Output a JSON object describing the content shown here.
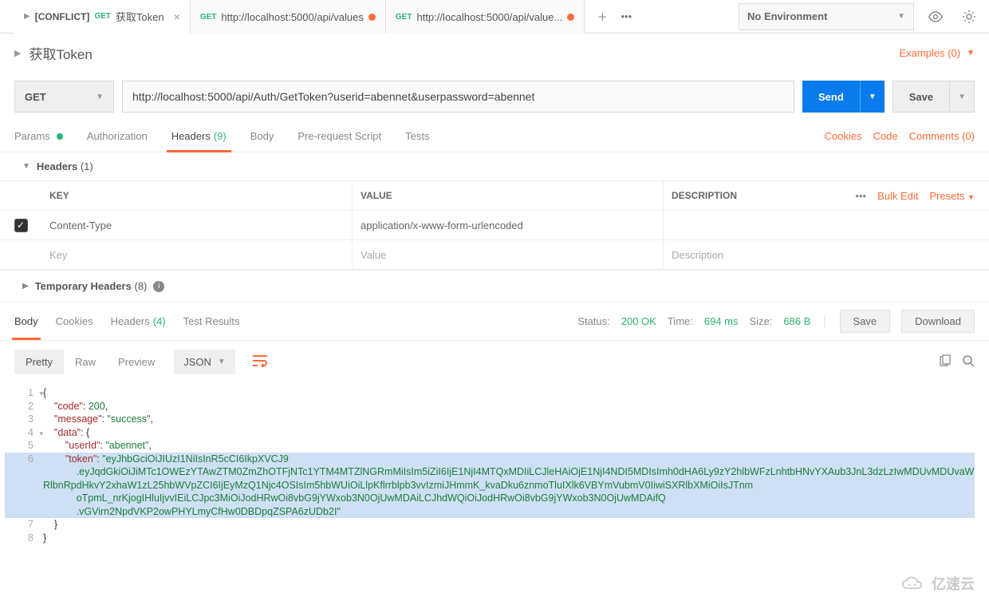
{
  "tabs": [
    {
      "conflict": "[CONFLICT]",
      "method": "GET",
      "title": "获取Token",
      "modified": false,
      "active": true
    },
    {
      "method": "GET",
      "title": "http://localhost:5000/api/values",
      "modified": true,
      "active": false
    },
    {
      "method": "GET",
      "title": "http://localhost:5000/api/value...",
      "modified": true,
      "active": false
    }
  ],
  "environment": {
    "selected": "No Environment"
  },
  "request": {
    "name": "获取Token",
    "examples": "Examples (0)",
    "method": "GET",
    "url": "http://localhost:5000/api/Auth/GetToken?userid=abennet&userpassword=abennet",
    "send": "Send",
    "save": "Save"
  },
  "reqtabs": {
    "params": "Params",
    "auth": "Authorization",
    "headers": "Headers",
    "headers_count": "(9)",
    "body": "Body",
    "prereq": "Pre-request Script",
    "tests": "Tests",
    "cookies": "Cookies",
    "code": "Code",
    "comments": "Comments (0)"
  },
  "headers_section": {
    "title": "Headers",
    "count": "(1)",
    "col_key": "KEY",
    "col_val": "VALUE",
    "col_desc": "DESCRIPTION",
    "bulk": "Bulk Edit",
    "presets": "Presets",
    "rows": [
      {
        "checked": true,
        "key": "Content-Type",
        "val": "application/x-www-form-urlencoded",
        "desc": ""
      }
    ],
    "ph_key": "Key",
    "ph_val": "Value",
    "ph_desc": "Description",
    "temp_title": "Temporary Headers",
    "temp_count": "(8)"
  },
  "resptabs": {
    "body": "Body",
    "cookies": "Cookies",
    "headers": "Headers",
    "headers_count": "(4)",
    "tests": "Test Results",
    "status_label": "Status:",
    "status_val": "200 OK",
    "time_label": "Time:",
    "time_val": "694 ms",
    "size_label": "Size:",
    "size_val": "686 B",
    "save": "Save",
    "download": "Download"
  },
  "bodybar": {
    "pretty": "Pretty",
    "raw": "Raw",
    "preview": "Preview",
    "format": "JSON"
  },
  "response_lines": {
    "l1": "{",
    "l2_key": "\"code\"",
    "l2_val": "200",
    "l3_key": "\"message\"",
    "l3_val": "\"success\"",
    "l4_key": "\"data\"",
    "l5_key": "\"userId\"",
    "l5_val": "\"abennet\"",
    "l6_key": "\"token\"",
    "l6_seg1": "eyJhbGciOiJIUzI1NiIsInR5cCI6IkpXVCJ9",
    "l6_seg2": ".eyJqdGkiOiJiMTc1OWEzYTAwZTM0ZmZhOTFjNTc1YTM4MTZlNGRmMiIsIm5iZiI6IjE1NjI4MTQxMDIiLCJleHAiOjE1NjI4NDI5MDIsImh0dHA6Ly9zY2hlbWFzLnhtbHNvYXAub3JnL3dzLzIwMDUvMDUvaWRlbnRpdHkvY2xhaW1zL25hbWVpZCI6IjEyMzQ1Njc4OSIsIm5hbWUiOiLlpKflrrblpb3vvIzmiJHmmK_kvaDku6znmoTluIXlk6VBYmVubmV0IiwiSXRlbXMiOiIsJTnm",
    "l6_seg3": "oTpmL_nrKjogIHluIjvvIEiLCJpc3MiOiJodHRwOi8vbG9jYWxob3N0OjUwMDAiLCJhdWQiOiJodHRwOi8vbG9jYWxob3N0OjUwMDAifQ",
    "l6_seg4": ".vGVirn2NpdVKP2owPHYLmyCfHw0DBDpqZSPA6zUDb2I",
    "l7": "}",
    "l8": "}"
  },
  "watermark": "亿速云"
}
